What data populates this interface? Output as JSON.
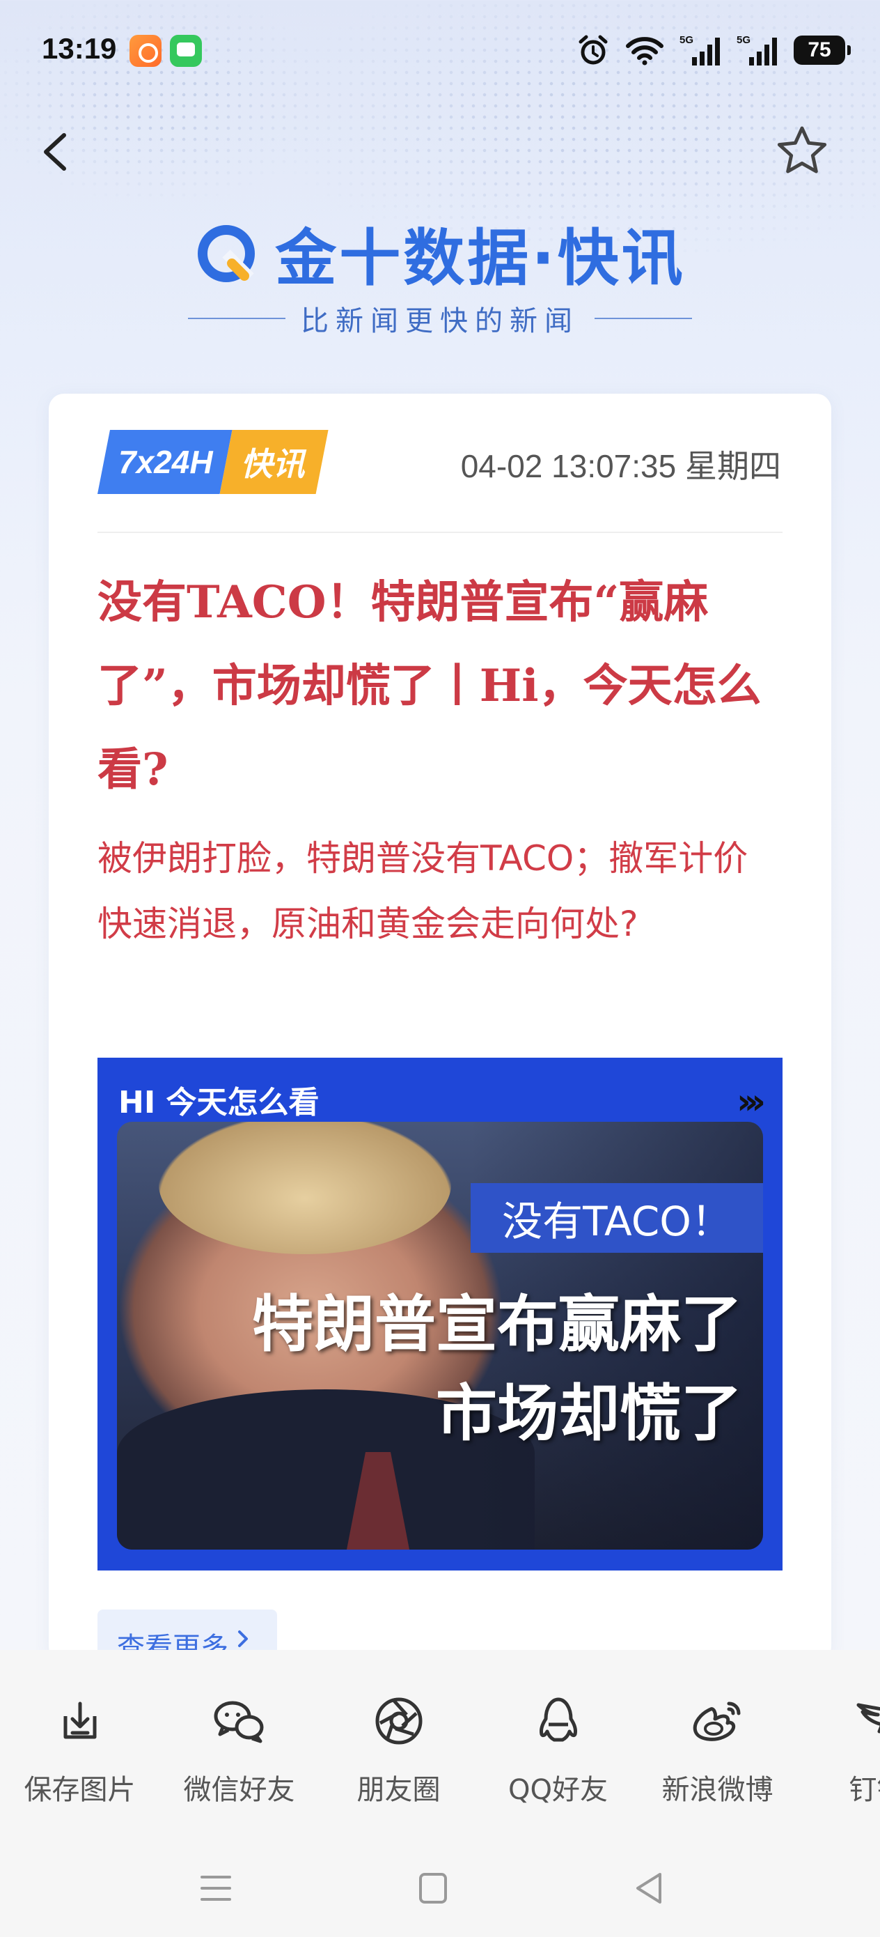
{
  "status_bar": {
    "time": "13:19",
    "network_1": "5G",
    "network_2": "5G",
    "battery": "75"
  },
  "nav": {
    "back_icon": "chevron-left-icon",
    "favorite_icon": "star-outline-icon"
  },
  "brand": {
    "title": "金十数据·快讯",
    "tagline": "比新闻更快的新闻",
    "color": "#2f6de0"
  },
  "article": {
    "tag_left": "7x24H",
    "tag_right": "快讯",
    "datetime": "04-02 13:07:35 星期四",
    "headline": "没有TACO！特朗普宣布“赢麻了”，市场却慌了丨Hi，今天怎么看?",
    "summary": "被伊朗打脸，特朗普没有TACO；撤军计价快速消退，原油和黄金会走向何处?",
    "headline_color": "#cc3a45",
    "image": {
      "label": "HI 今天怎么看",
      "arrows": "›››",
      "kicker": "没有TACO！",
      "line1": "特朗普宣布赢麻了",
      "line2": "市场却慌了"
    },
    "more_label": "查看更多"
  },
  "share": {
    "items": [
      {
        "label": "保存图片",
        "icon": "download-icon"
      },
      {
        "label": "微信好友",
        "icon": "wechat-icon"
      },
      {
        "label": "朋友圈",
        "icon": "moments-icon"
      },
      {
        "label": "QQ好友",
        "icon": "qq-icon"
      },
      {
        "label": "新浪微博",
        "icon": "weibo-icon"
      },
      {
        "label": "钉钉",
        "icon": "dingtalk-icon"
      }
    ]
  }
}
